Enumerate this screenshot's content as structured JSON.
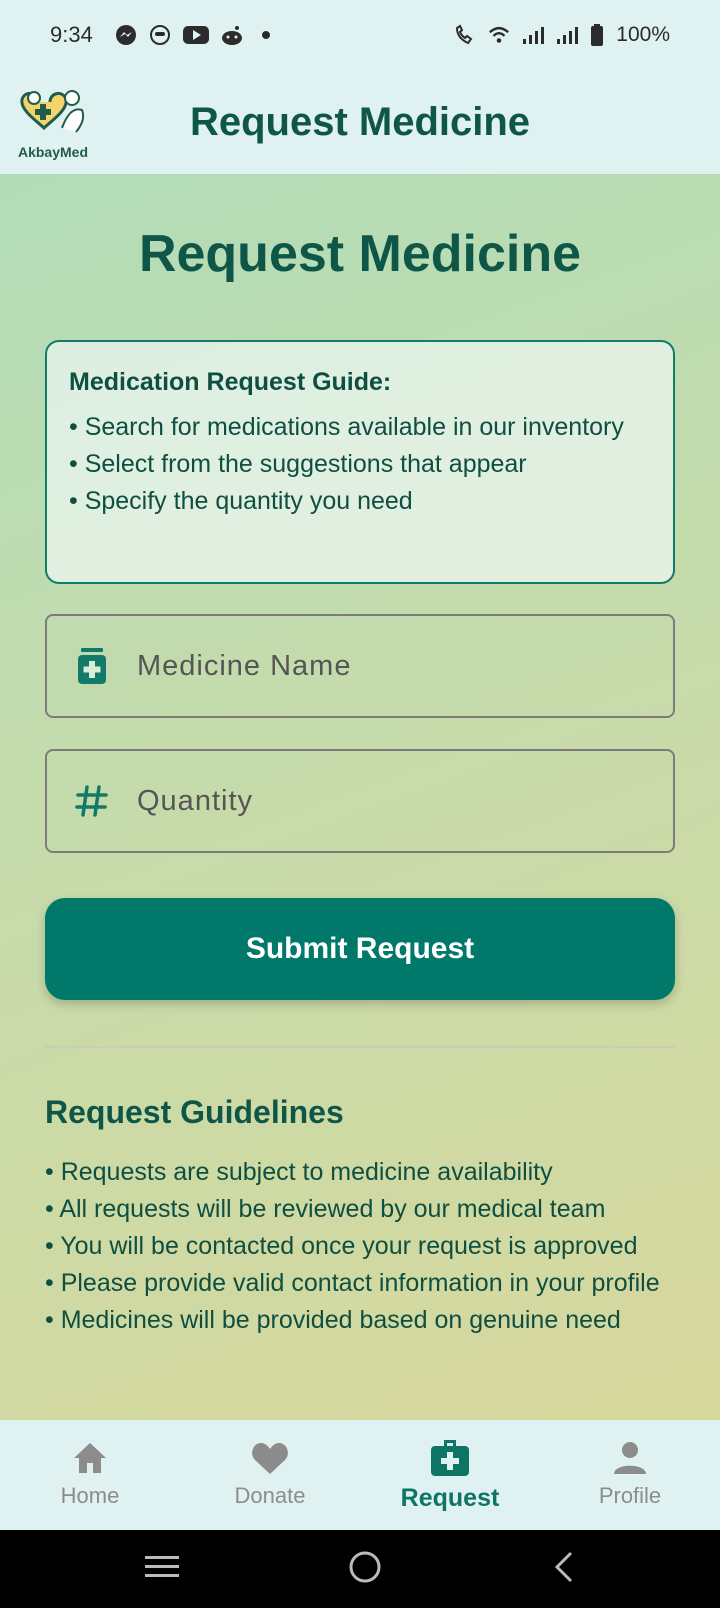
{
  "status_bar": {
    "time": "9:34",
    "battery": "100%",
    "left_icons": [
      "messenger-icon",
      "face-icon",
      "youtube-icon",
      "reddit-icon",
      "dot-icon"
    ],
    "right_icons": [
      "wifi-call-icon",
      "wifi-icon",
      "signal-icon",
      "signal-icon-2",
      "battery-icon"
    ]
  },
  "app_bar": {
    "logo_text": "AkbayMed",
    "title": "Request Medicine"
  },
  "main": {
    "title": "Request Medicine",
    "guide": {
      "title": "Medication Request Guide:",
      "items": [
        "• Search for medications available in our inventory",
        "• Select from the suggestions that appear",
        "• Specify the quantity you need"
      ]
    },
    "medicine_field": {
      "placeholder": "Medicine Name",
      "icon": "medicine-bottle-icon"
    },
    "quantity_field": {
      "placeholder": "Quantity",
      "icon": "hash-icon"
    },
    "submit_label": "Submit Request",
    "guidelines": {
      "title": "Request Guidelines",
      "items": [
        "• Requests are subject to medicine availability",
        "• All requests will be reviewed by our medical team",
        "• You will be contacted once your request is approved",
        "• Please provide valid contact information in your profile",
        "• Medicines will be provided based on genuine need"
      ]
    }
  },
  "bottom_nav": {
    "items": [
      {
        "label": "Home",
        "icon": "home-icon"
      },
      {
        "label": "Donate",
        "icon": "heart-icon"
      },
      {
        "label": "Request",
        "icon": "medical-kit-icon",
        "active": true
      },
      {
        "label": "Profile",
        "icon": "person-icon"
      }
    ]
  },
  "colors": {
    "primary": "#00796b",
    "title": "#0e5748",
    "bar_bg": "#e0f1f1",
    "inactive_nav": "#8c8c8c"
  }
}
